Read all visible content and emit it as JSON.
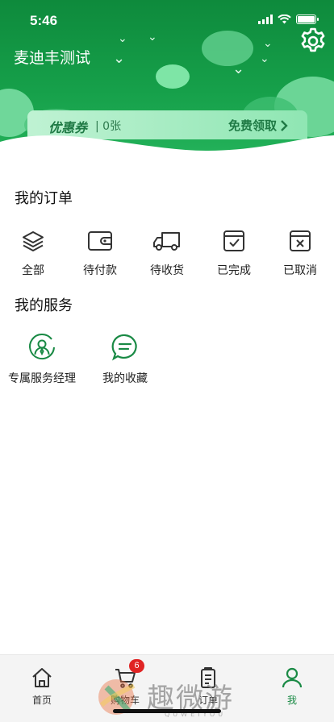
{
  "status_bar": {
    "time": "5:46"
  },
  "header": {
    "user_name": "麦迪丰测试",
    "icons": [
      "gear-icon"
    ]
  },
  "coupon": {
    "title": "优惠券",
    "count": "| 0张",
    "claim_label": "免费领取"
  },
  "orders": {
    "title": "我的订单",
    "items": [
      {
        "label": "全部",
        "icon": "layers-icon"
      },
      {
        "label": "待付款",
        "icon": "wallet-icon"
      },
      {
        "label": "待收货",
        "icon": "truck-icon"
      },
      {
        "label": "已完成",
        "icon": "check-box-icon"
      },
      {
        "label": "已取消",
        "icon": "cancel-box-icon"
      }
    ]
  },
  "services": {
    "title": "我的服务",
    "items": [
      {
        "label": "专属服务经理",
        "icon": "manager-icon"
      },
      {
        "label": "我的收藏",
        "icon": "chat-bubble-icon"
      }
    ]
  },
  "tabbar": {
    "items": [
      {
        "label": "首页",
        "icon": "home-icon"
      },
      {
        "label": "购物车",
        "icon": "cart-icon",
        "badge": "6"
      },
      {
        "label": "订单",
        "icon": "order-icon"
      },
      {
        "label": "我",
        "icon": "user-icon",
        "active": true
      }
    ]
  },
  "watermark": {
    "text": "趣微游",
    "sub": "QUWEIYOU"
  },
  "colors": {
    "primary": "#1a8a45",
    "header": "#16a04a",
    "badge": "#e02424"
  }
}
